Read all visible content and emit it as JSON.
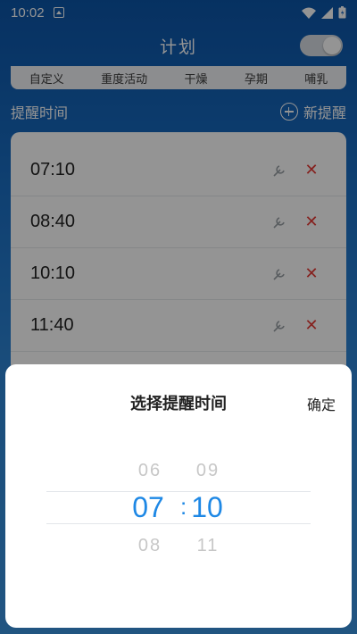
{
  "status_bar": {
    "time": "10:02"
  },
  "header": {
    "title": "计划"
  },
  "modes": [
    "自定义",
    "重度活动",
    "干燥",
    "孕期",
    "哺乳"
  ],
  "section": {
    "title": "提醒时间",
    "new_label": "新提醒"
  },
  "reminders": [
    {
      "time": "07:10"
    },
    {
      "time": "08:40"
    },
    {
      "time": "10:10"
    },
    {
      "time": "11:40"
    }
  ],
  "picker": {
    "title": "选择提醒时间",
    "confirm_label": "确定",
    "hour": {
      "prev": "06",
      "selected": "07",
      "next": "08"
    },
    "minute": {
      "prev": "09",
      "selected": "10",
      "next": "11"
    },
    "separator": ":"
  },
  "colors": {
    "accent": "#1e88e5",
    "delete": "#e53935",
    "primary_bg": "#1565c0"
  }
}
